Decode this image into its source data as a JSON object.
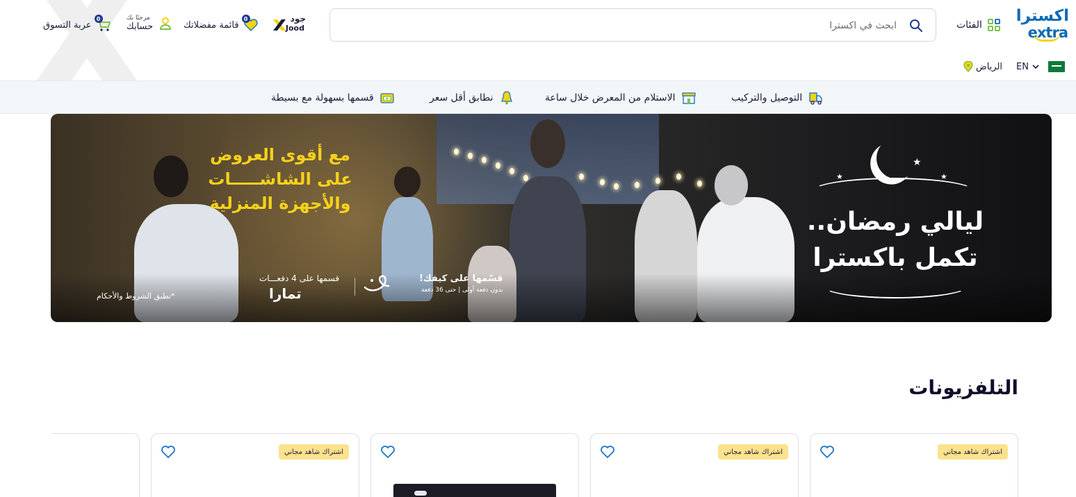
{
  "header": {
    "logo": {
      "arabic": "اكسترا",
      "latin": "extra"
    },
    "categories_label": "الفئات",
    "search_placeholder": "ابحث في اكسترا",
    "jood": {
      "arabic": "جود",
      "latin": "Jood"
    },
    "favorites": {
      "label": "قائمة مفضلاتك",
      "count": "0"
    },
    "account": {
      "greeting": "مرحبًا بك",
      "label": "حسابك"
    },
    "cart": {
      "label": "عربة التسوق",
      "count": "0"
    },
    "language": "EN",
    "city": "الرياض"
  },
  "services": [
    {
      "label": "التوصيل والتركيب",
      "icon": "delivery-truck-icon"
    },
    {
      "label": "الاستلام من المعرض خلال ساعة",
      "icon": "store-pickup-icon"
    },
    {
      "label": "نطابق أقل سعر",
      "icon": "price-match-bell-icon"
    },
    {
      "label": "قسمها بسهولة مع بسيطة",
      "icon": "wallet-icon"
    }
  ],
  "banner": {
    "headline_lines": [
      "مع أقوى العروض",
      "على الشاشـــــات",
      "والأجهزة المنزلية"
    ],
    "title_lines": [
      "ليالي رمضان..",
      "تكمل باكسترا"
    ],
    "basita_line1": "قسّمها على كيفك!",
    "basita_line2": "بدون دفعة أولى | حتى 36 دفعة",
    "tamara_caption": "قسمها على 4 دفعـــات",
    "tamara_brand": "تمارا",
    "terms": "*تطبق الشروط والأحكام"
  },
  "section": {
    "title": "التلفزيونات"
  },
  "products": [
    {
      "tag": "اشتراك شاهد مجاني",
      "has_image": false
    },
    {
      "tag": "اشتراك شاهد مجاني",
      "has_image": false
    },
    {
      "tag": "",
      "has_image": true
    },
    {
      "tag": "اشتراك شاهد مجاني",
      "has_image": false
    }
  ],
  "colors": {
    "brand_blue": "#0a6bb6",
    "brand_yellow": "#f5d312",
    "tag_yellow": "#fbe28c",
    "text_dark": "#1b1b3a"
  }
}
